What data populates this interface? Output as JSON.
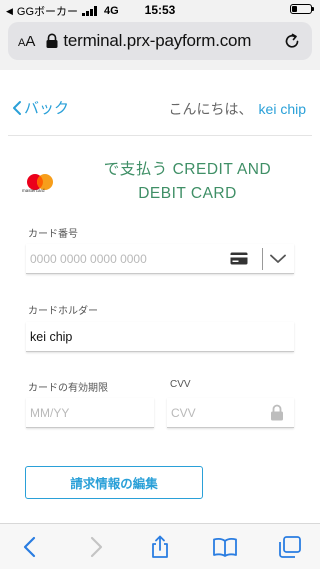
{
  "status_bar": {
    "carrier": "GGボーカー",
    "network": "4G",
    "time": "15:53",
    "battery_level": 0.3
  },
  "browser": {
    "text_size_label": "AA",
    "url": "terminal.prx-payform.com"
  },
  "nav": {
    "back_label": "バック",
    "greeting": "こんにちは、",
    "user_name": "kei chip"
  },
  "payment": {
    "brand_icon": "mastercard-logo",
    "brand_text": "mastercard",
    "title_line1": "で支払う CREDIT AND",
    "title_line2": "DEBIT CARD"
  },
  "form": {
    "card_number_label": "カード番号",
    "card_number_placeholder": "0000 0000 0000 0000",
    "cardholder_label": "カードホルダー",
    "cardholder_value": "kei chip",
    "expiry_label": "カードの有効期限",
    "expiry_placeholder": "MM/YY",
    "cvv_label": "CVV",
    "cvv_placeholder": "CVV"
  },
  "actions": {
    "edit_billing_label": "請求情報の編集"
  },
  "toolbar": {
    "items": [
      "back-arrow-icon",
      "forward-arrow-icon",
      "share-icon",
      "bookmarks-icon",
      "tabs-icon"
    ]
  },
  "colors": {
    "accent": "#2aa0d8",
    "title_green": "#3f8f66",
    "mastercard_red": "#eb001b",
    "mastercard_orange": "#f79e1b"
  }
}
